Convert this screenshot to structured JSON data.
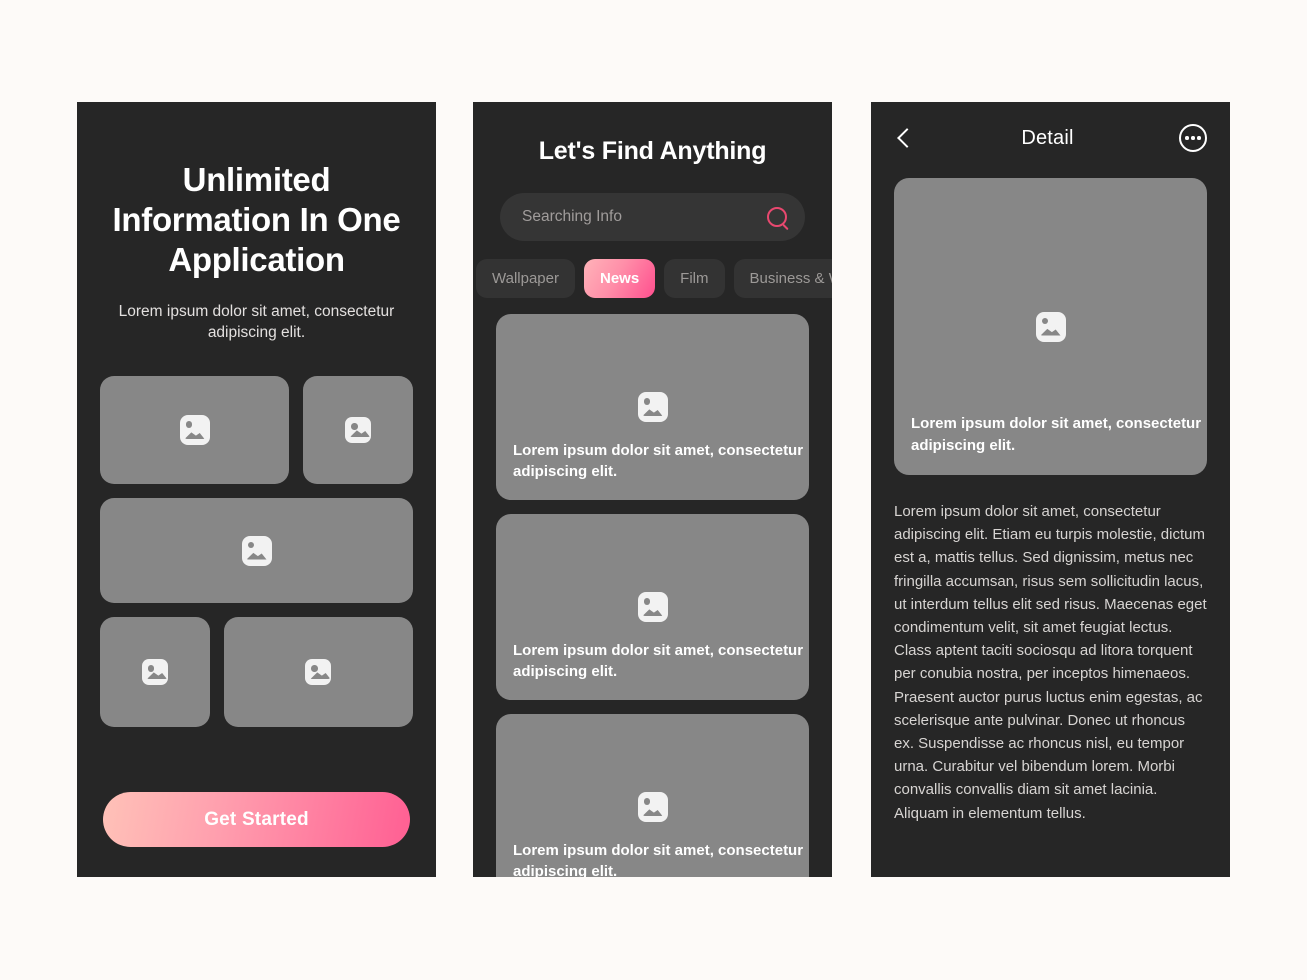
{
  "theme": {
    "page_background": "#fdfaf8",
    "panel_background": "#262626",
    "card_grey": "#878787",
    "accent_pink": "#ff4f8e",
    "accent_pink_light": "#ffb3b9",
    "search_icon_pink": "#e8486f"
  },
  "onboarding": {
    "title": "Unlimited Information In One Application",
    "subtitle": "Lorem ipsum dolor sit amet, consectetur adipiscing elit.",
    "cta_label": "Get Started",
    "tiles": [
      {
        "name": "tile-1",
        "icon": "image-placeholder-icon"
      },
      {
        "name": "tile-2",
        "icon": "image-placeholder-icon"
      },
      {
        "name": "tile-3",
        "icon": "image-placeholder-icon"
      },
      {
        "name": "tile-4",
        "icon": "image-placeholder-icon"
      },
      {
        "name": "tile-5",
        "icon": "image-placeholder-icon"
      }
    ]
  },
  "search": {
    "title": "Let's Find Anything",
    "input_value": "",
    "placeholder": "Searching Info",
    "search_icon": "search-icon",
    "chips": [
      {
        "label": "Wallpaper",
        "active": false
      },
      {
        "label": "News",
        "active": true
      },
      {
        "label": "Film",
        "active": false
      },
      {
        "label": "Business & Work",
        "active": false
      }
    ],
    "cards": [
      {
        "caption": "Lorem ipsum dolor sit amet, consectetur adipiscing elit.",
        "icon": "image-placeholder-icon"
      },
      {
        "caption": "Lorem ipsum dolor sit amet, consectetur adipiscing elit.",
        "icon": "image-placeholder-icon"
      },
      {
        "caption": "Lorem ipsum dolor sit amet, consectetur adipiscing elit.",
        "icon": "image-placeholder-icon"
      }
    ]
  },
  "detail": {
    "back_icon": "back-chevron-icon",
    "title": "Detail",
    "more_icon": "more-options-icon",
    "hero": {
      "icon": "image-placeholder-icon",
      "caption": "Lorem ipsum dolor sit amet, consectetur adipiscing elit."
    },
    "body": "Lorem ipsum dolor sit amet, consectetur adipiscing elit. Etiam eu turpis molestie, dictum est a, mattis tellus. Sed dignissim, metus nec fringilla accumsan, risus sem sollicitudin lacus, ut interdum tellus elit sed risus. Maecenas eget condimentum velit, sit amet feugiat lectus. Class aptent taciti sociosqu ad litora torquent per conubia nostra, per inceptos himenaeos. Praesent auctor purus luctus enim egestas, ac scelerisque ante pulvinar. Donec ut rhoncus ex. Suspendisse ac rhoncus nisl, eu tempor urna. Curabitur vel bibendum lorem. Morbi convallis convallis diam sit amet lacinia. Aliquam in elementum tellus."
  }
}
